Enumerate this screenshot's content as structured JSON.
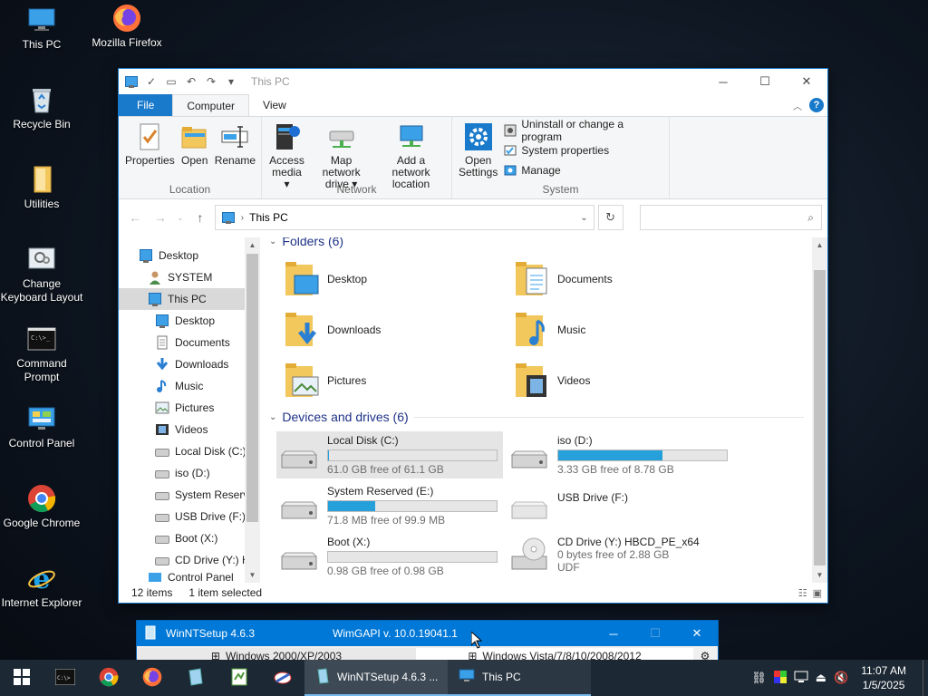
{
  "desktop": {
    "icons": [
      {
        "label": "This PC"
      },
      {
        "label": "Recycle Bin"
      },
      {
        "label": "Utilities"
      },
      {
        "label": "Change Keyboard Layout"
      },
      {
        "label": "Command Prompt"
      },
      {
        "label": "Control Panel"
      },
      {
        "label": "Google Chrome"
      },
      {
        "label": "Internet Explorer"
      }
    ],
    "firefox": {
      "label": "Mozilla Firefox"
    }
  },
  "explorer": {
    "title": "This PC",
    "tabs": {
      "file": "File",
      "computer": "Computer",
      "view": "View"
    },
    "ribbon": {
      "location": {
        "name": "Location",
        "buttons": [
          {
            "label": "Properties"
          },
          {
            "label": "Open"
          },
          {
            "label": "Rename"
          }
        ]
      },
      "network": {
        "name": "Network",
        "access_media": {
          "line1": "Access",
          "line2": "media ▾"
        },
        "map_drive": {
          "line1": "Map network",
          "line2": "drive ▾"
        },
        "add_location": {
          "line1": "Add a network",
          "line2": "location"
        }
      },
      "system": {
        "name": "System",
        "open_settings": {
          "line1": "Open",
          "line2": "Settings"
        },
        "uninstall": "Uninstall or change a program",
        "system_properties": "System properties",
        "manage": "Manage"
      }
    },
    "address": {
      "path": "This PC",
      "search_placeholder": ""
    },
    "nav": [
      {
        "label": "Desktop"
      },
      {
        "label": "SYSTEM"
      },
      {
        "label": "This PC"
      },
      {
        "label": "Desktop"
      },
      {
        "label": "Documents"
      },
      {
        "label": "Downloads"
      },
      {
        "label": "Music"
      },
      {
        "label": "Pictures"
      },
      {
        "label": "Videos"
      },
      {
        "label": "Local Disk (C:)"
      },
      {
        "label": "iso (D:)"
      },
      {
        "label": "System Reserve"
      },
      {
        "label": "USB Drive (F:)"
      },
      {
        "label": "Boot (X:)"
      },
      {
        "label": "CD Drive (Y:) H"
      },
      {
        "label": "Control Panel"
      }
    ],
    "folders_header": "Folders (6)",
    "folders": [
      {
        "label": "Desktop"
      },
      {
        "label": "Documents"
      },
      {
        "label": "Downloads"
      },
      {
        "label": "Music"
      },
      {
        "label": "Pictures"
      },
      {
        "label": "Videos"
      }
    ],
    "drives_header": "Devices and drives (6)",
    "drives": [
      {
        "name": "Local Disk (C:)",
        "free": "61.0 GB free of 61.1 GB",
        "used_fraction": 0.002
      },
      {
        "name": "iso (D:)",
        "free": "3.33 GB free of 8.78 GB",
        "used_fraction": 0.62
      },
      {
        "name": "System Reserved (E:)",
        "free": "71.8 MB free of 99.9 MB",
        "used_fraction": 0.28
      },
      {
        "name": "USB Drive (F:)"
      },
      {
        "name": "Boot (X:)",
        "free": "0.98 GB free of 0.98 GB",
        "used_fraction": 0.0
      },
      {
        "name": "CD Drive (Y:) HBCD_PE_x64",
        "free": "0 bytes free of 2.88 GB",
        "fs": "UDF"
      }
    ],
    "status": {
      "items": "12 items",
      "selected": "1 item selected"
    }
  },
  "winntsetup": {
    "title": "WinNTSetup 4.6.3",
    "wim": "WimGAPI v. 10.0.19041.1",
    "tab1": "Windows 2000/XP/2003",
    "tab2": "Windows Vista/7/8/10/2008/2012"
  },
  "taskbar": {
    "tasks": [
      {
        "label": "WinNTSetup 4.6.3 ..."
      },
      {
        "label": "This PC"
      }
    ],
    "time": "11:07 AM",
    "date": "1/5/2025"
  }
}
